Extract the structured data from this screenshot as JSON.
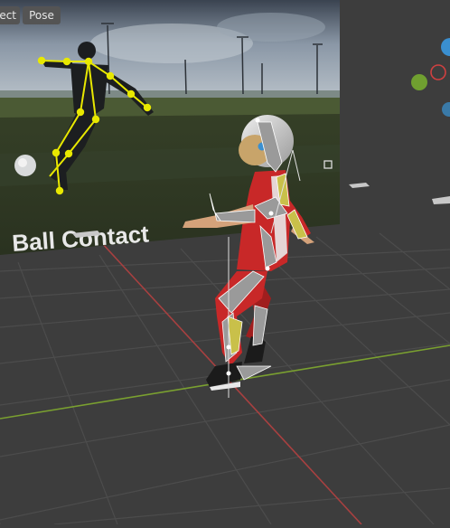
{
  "header": {
    "select_label": "ect",
    "pose_label": "Pose"
  },
  "reference_image": {
    "caption": "Ball Contact"
  },
  "colors": {
    "viewport_bg": "#3d3d3d",
    "grid_line": "#4a4a4a",
    "x_axis": "#b04040",
    "y_axis": "#7aa030",
    "joint": "#e8e800",
    "suit_red": "#c82828",
    "gizmo_z": "#3a8fd0",
    "gizmo_x": "#d04040",
    "gizmo_y": "#70a030"
  },
  "icons": [
    "camera-icon",
    "light-icon",
    "view-gizmo-icon"
  ]
}
